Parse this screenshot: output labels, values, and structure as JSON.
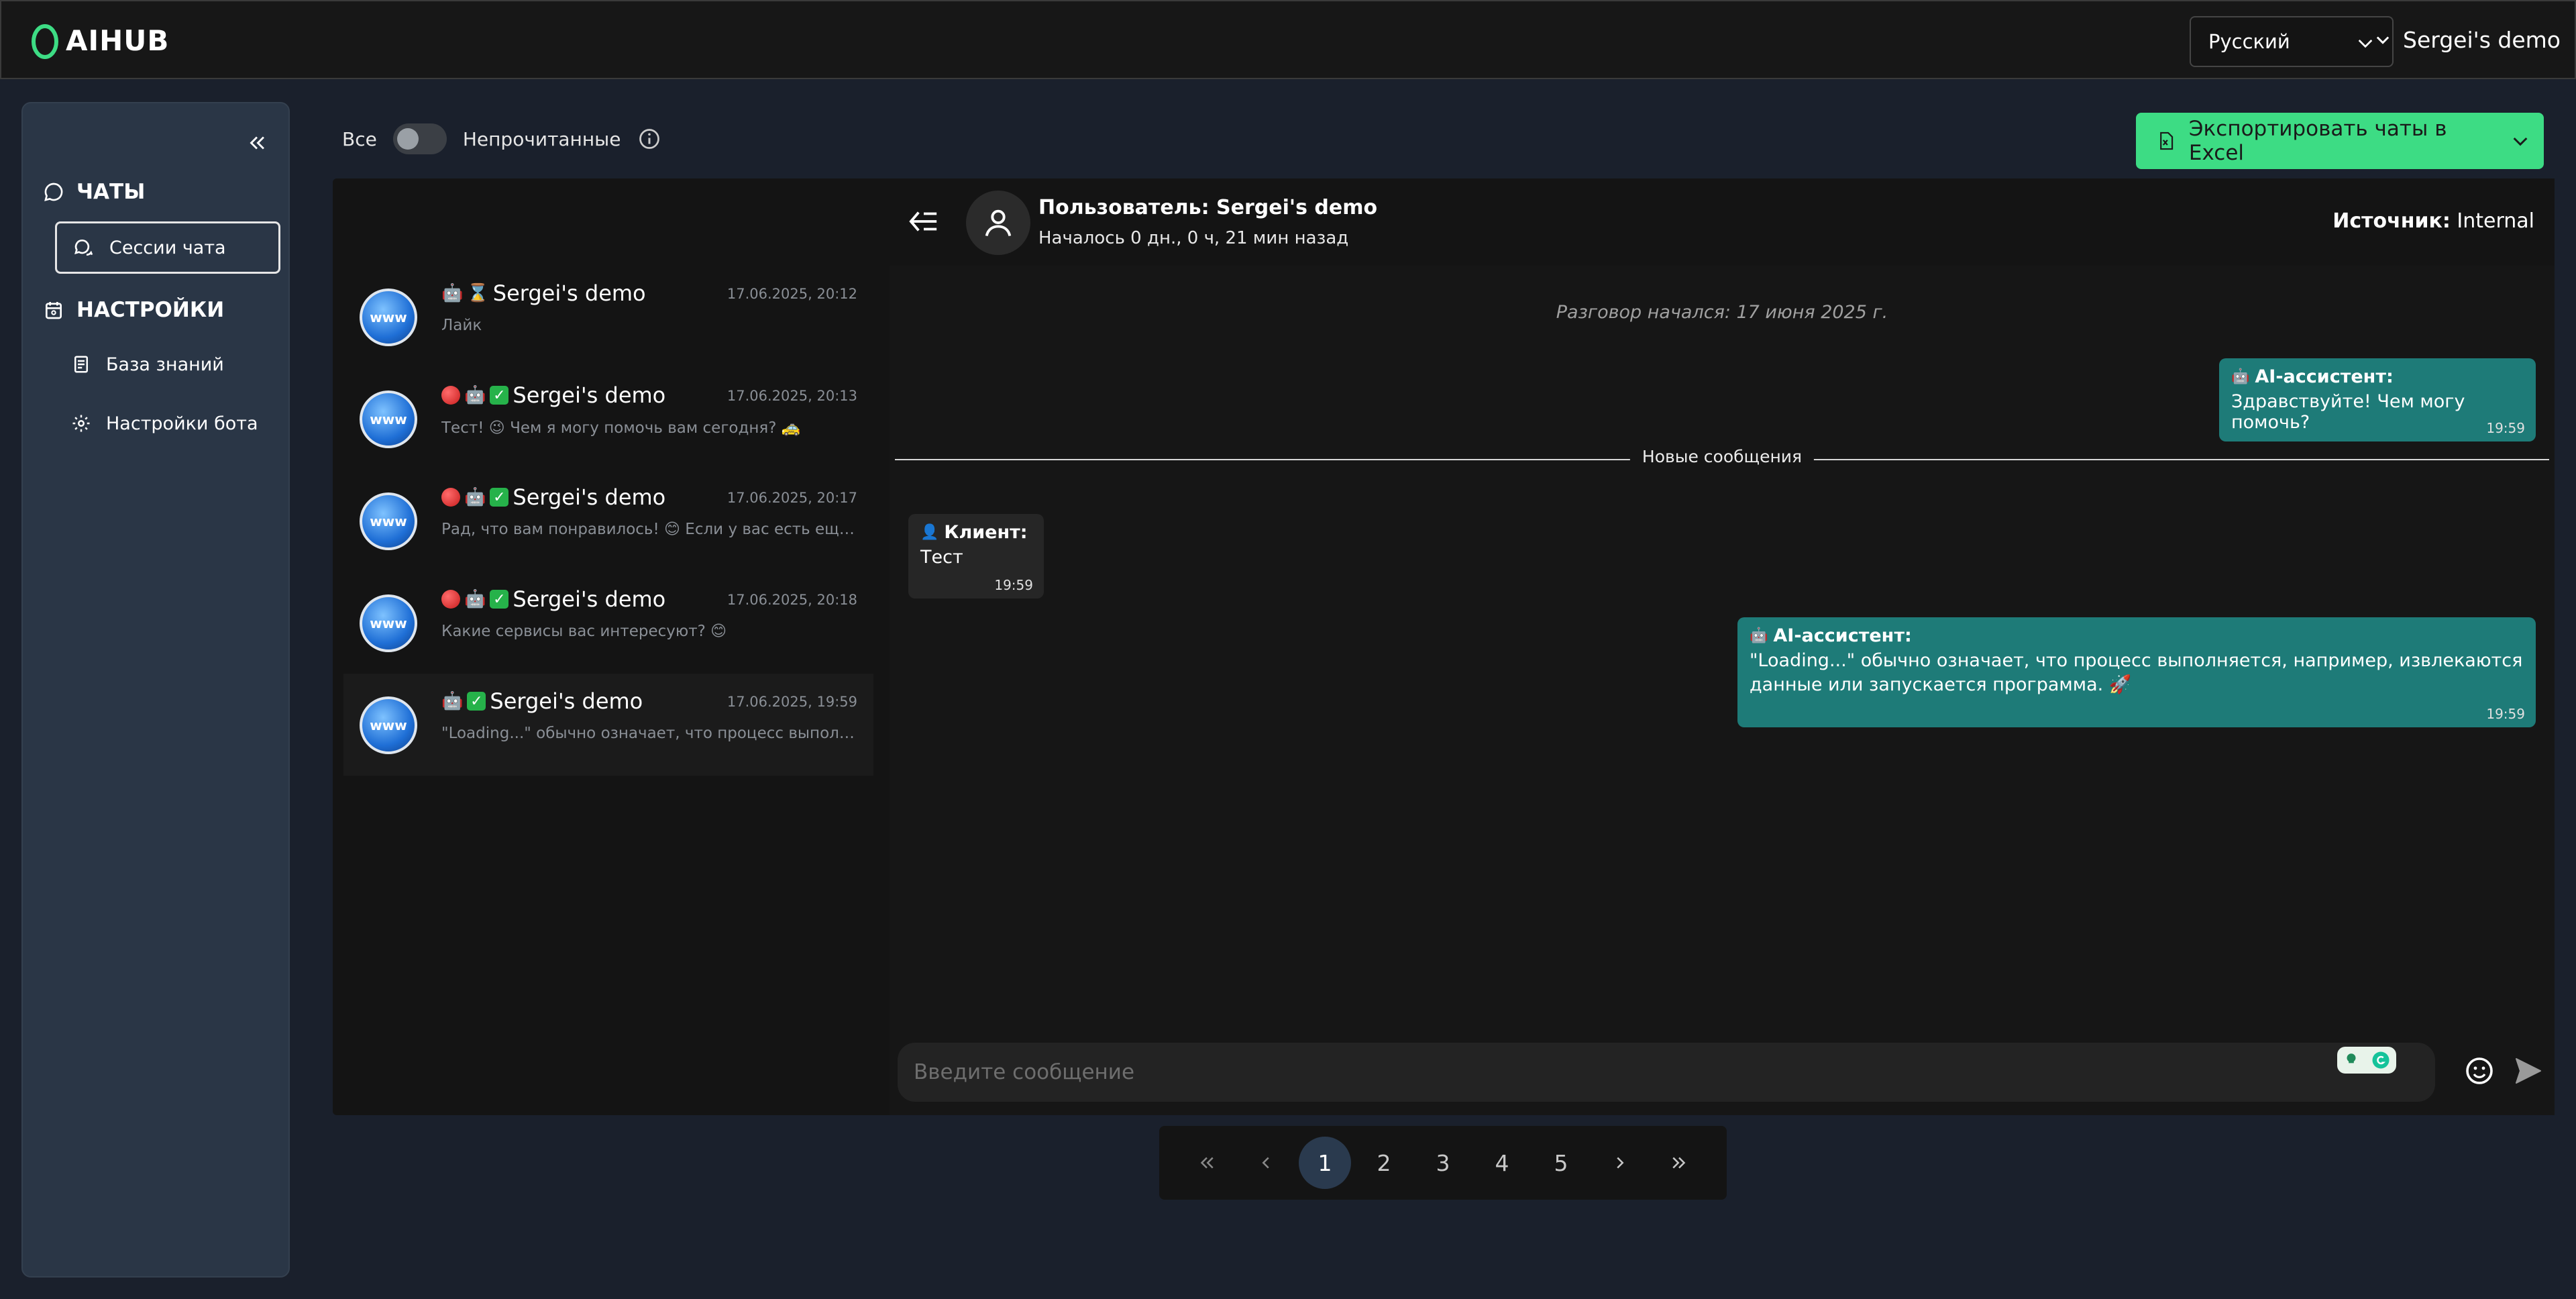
{
  "app": {
    "logo_text": "AIHUB"
  },
  "header": {
    "language": "Русский",
    "account_name": "Sergei's demo"
  },
  "sidebar": {
    "chats_title": "ЧАТЫ",
    "chat_sessions": "Сессии чата",
    "settings_title": "НАСТРОЙКИ",
    "knowledge_base": "База знаний",
    "bot_settings": "Настройки бота"
  },
  "filter": {
    "all_label": "Все",
    "unread_label": "Непрочитанные"
  },
  "export": {
    "label": "Экспортировать чаты в Excel"
  },
  "chat_list": [
    {
      "name": "Sergei's demo",
      "time": "17.06.2025, 20:12",
      "preview": "Лайк",
      "badges": [
        "robot",
        "hourglass"
      ]
    },
    {
      "name": "Sergei's demo",
      "time": "17.06.2025, 20:13",
      "preview": "Тест! 😉 Чем я могу помочь вам сегодня? 🚕",
      "badges": [
        "red",
        "robot",
        "check"
      ]
    },
    {
      "name": "Sergei's demo",
      "time": "17.06.2025, 20:17",
      "preview": "Рад, что вам понравилось! 😊 Если у вас есть еще воп...",
      "badges": [
        "red",
        "robot",
        "check"
      ]
    },
    {
      "name": "Sergei's demo",
      "time": "17.06.2025, 20:18",
      "preview": "Какие сервисы                        вас интересуют? 😊",
      "badges": [
        "red",
        "robot",
        "check"
      ]
    },
    {
      "name": "Sergei's demo",
      "time": "17.06.2025, 19:59",
      "preview": "\"Loading...\" обычно означает, что процесс выполняет...",
      "badges": [
        "robot",
        "check"
      ]
    }
  ],
  "avatar_text": "www",
  "conversation": {
    "title": "Пользователь: Sergei's demo",
    "subtitle": "Началось 0 дн., 0 ч, 21 мин назад",
    "source_label": "Источник:",
    "source_value": "Internal",
    "started": "Разговор начался: 17 июня 2025 г.",
    "new_messages": "Новые сообщения",
    "messages": [
      {
        "role": "ai",
        "author": "AI-ассистент:",
        "text": "Здравствуйте! Чем могу помочь?",
        "time": "19:59"
      },
      {
        "role": "client",
        "author": "Клиент:",
        "text": "Тест",
        "time": "19:59"
      },
      {
        "role": "ai",
        "author": "AI-ассистент:",
        "text_line1": "\"Loading...\" обычно означает, что процесс выполняется, например, извлекаются",
        "text_line2": "данные или запускается программа. 🚀",
        "time": "19:59"
      }
    ],
    "input_placeholder": "Введите сообщение"
  },
  "pagination": {
    "pages": [
      "1",
      "2",
      "3",
      "4",
      "5"
    ],
    "current": "1"
  }
}
